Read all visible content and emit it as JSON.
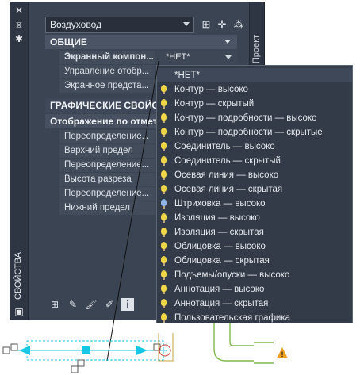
{
  "palette": {
    "title": "СВОЙСТВА",
    "side_tab": "Проект",
    "type_select": "Воздуховод",
    "sections": [
      {
        "id": "general",
        "label": "ОБЩИЕ"
      },
      {
        "id": "graphics",
        "label": "ГРАФИЧЕСКИЕ СВОЙСТ"
      }
    ],
    "general_rows": [
      {
        "label": "Экранный компон...",
        "value": "*НЕТ*",
        "active": true
      },
      {
        "label": "Управление отобр...",
        "value": ""
      },
      {
        "label": "Экранное предста...",
        "value": ""
      }
    ],
    "graphics_header": "Отображение по отмет",
    "graphics_rows": [
      {
        "label": "Переопределение..."
      },
      {
        "label": "Верхний предел"
      },
      {
        "label": "Переопределение..."
      },
      {
        "label": "Высота разреза"
      },
      {
        "label": "Переопределение..."
      },
      {
        "label": "Нижний предел"
      }
    ]
  },
  "dropdown": {
    "items": [
      {
        "label": "*НЕТ*",
        "icon": "none",
        "selected": true
      },
      {
        "label": "Контур — высоко",
        "icon": "bulb-yellow"
      },
      {
        "label": "Контур — скрытый",
        "icon": "bulb-yellow"
      },
      {
        "label": "Контур — подробности — высоко",
        "icon": "bulb-yellow"
      },
      {
        "label": "Контур — подробности — скрытые",
        "icon": "bulb-yellow"
      },
      {
        "label": "Соединитель — высоко",
        "icon": "bulb-yellow"
      },
      {
        "label": "Соединитель — скрытый",
        "icon": "bulb-yellow"
      },
      {
        "label": "Осевая линия — высоко",
        "icon": "bulb-yellow"
      },
      {
        "label": "Осевая линия — скрытая",
        "icon": "bulb-yellow"
      },
      {
        "label": "Штриховка — высоко",
        "icon": "bulb-blue"
      },
      {
        "label": "Изоляция — высоко",
        "icon": "bulb-yellow"
      },
      {
        "label": "Изоляция — скрытая",
        "icon": "bulb-yellow"
      },
      {
        "label": "Облицовка — высоко",
        "icon": "bulb-yellow"
      },
      {
        "label": "Облицовка — скрытая",
        "icon": "bulb-yellow"
      },
      {
        "label": "Подъемы/опуски — высоко",
        "icon": "bulb-yellow"
      },
      {
        "label": "Аннотация — высоко",
        "icon": "bulb-yellow"
      },
      {
        "label": "Аннотация — скрытая",
        "icon": "bulb-yellow"
      },
      {
        "label": "Пользовательская графика",
        "icon": "bulb-yellow"
      }
    ]
  },
  "colors": {
    "palette_bg": "#3b4453",
    "dropdown_bg": "#333b48",
    "duct_cyan": "#19c6e6",
    "drawing_green": "#7fb84a",
    "warning_orange": "#f0a020"
  }
}
